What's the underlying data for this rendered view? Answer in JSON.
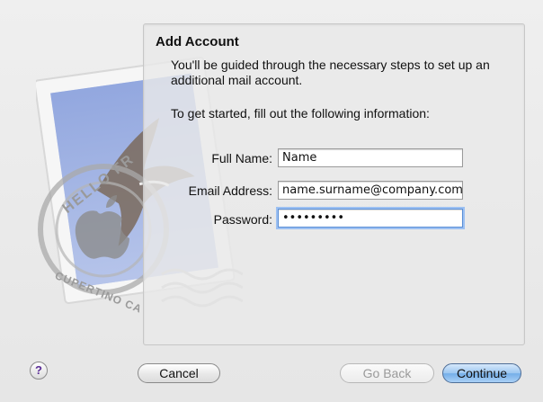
{
  "dialog": {
    "title": "Add Account",
    "intro": "You'll be guided through the necessary steps to set up an additional mail account.",
    "prompt": "To get started, fill out the following information:"
  },
  "form": {
    "full_name_label": "Full Name:",
    "full_name_value": "Name",
    "email_label": "Email Address:",
    "email_value": "name.surname@company.com",
    "password_label": "Password:",
    "password_value": "•••••••••"
  },
  "stamp": {
    "text_top": "HELLO FR",
    "text_bottom": "CUPERTINO CA"
  },
  "buttons": {
    "help_label": "?",
    "cancel_label": "Cancel",
    "back_label": "Go Back",
    "continue_label": "Continue"
  },
  "colors": {
    "accent": "#74aee8",
    "stamp_blue": "#8fa4d8"
  },
  "icons": {
    "help": "question-mark-icon",
    "stamp": "mail-stamp-icon"
  }
}
